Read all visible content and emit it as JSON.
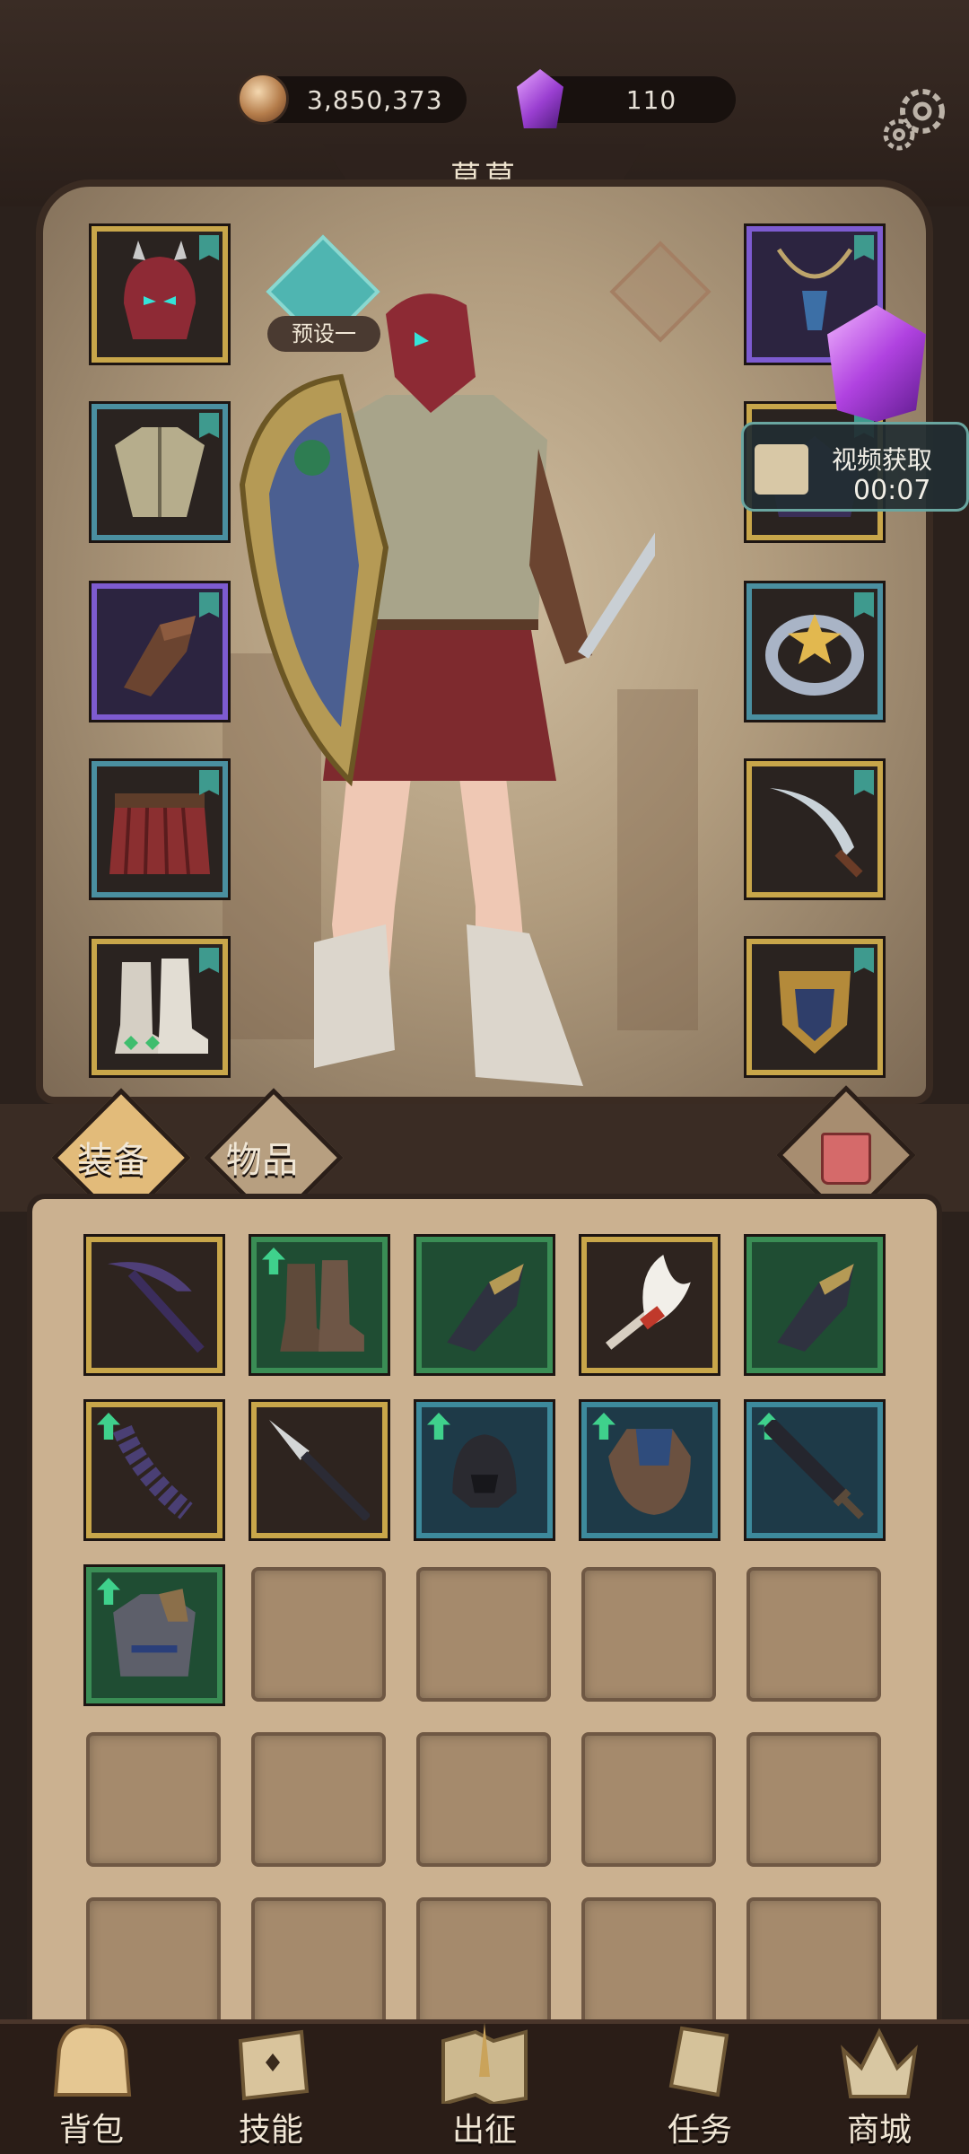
{
  "currency": {
    "coins": "3,850,373",
    "gems": "110"
  },
  "character": {
    "name": "莫莫",
    "preset_label": "预设一"
  },
  "video_offer": {
    "label": "视频获取",
    "timer": "00:07"
  },
  "tabs": {
    "equipment": "装备",
    "items": "物品"
  },
  "nav": {
    "bag": "背包",
    "skills": "技能",
    "expedition": "出征",
    "quests": "任务",
    "shop": "商城"
  },
  "equipped_left": [
    "helmet",
    "chest-armor",
    "gauntlets",
    "skirt",
    "boots"
  ],
  "equipped_right": [
    "necklace",
    "cloak",
    "ring",
    "dagger",
    "shield-emblem"
  ],
  "inventory_items": [
    {
      "name": "scythe",
      "rarity": "gold",
      "upgrade": false
    },
    {
      "name": "boots",
      "rarity": "green",
      "upgrade": true
    },
    {
      "name": "gauntlet",
      "rarity": "green",
      "upgrade": false
    },
    {
      "name": "torch",
      "rarity": "gold",
      "upgrade": false
    },
    {
      "name": "gauntlet",
      "rarity": "green",
      "upgrade": false
    },
    {
      "name": "scale-whip",
      "rarity": "gold",
      "upgrade": true
    },
    {
      "name": "spear",
      "rarity": "gold",
      "upgrade": false
    },
    {
      "name": "dark-helmet",
      "rarity": "blue",
      "upgrade": true
    },
    {
      "name": "shield-cape",
      "rarity": "blue",
      "upgrade": true
    },
    {
      "name": "greatsword",
      "rarity": "blue",
      "upgrade": true
    },
    {
      "name": "wolf-armor",
      "rarity": "green",
      "upgrade": true
    }
  ]
}
